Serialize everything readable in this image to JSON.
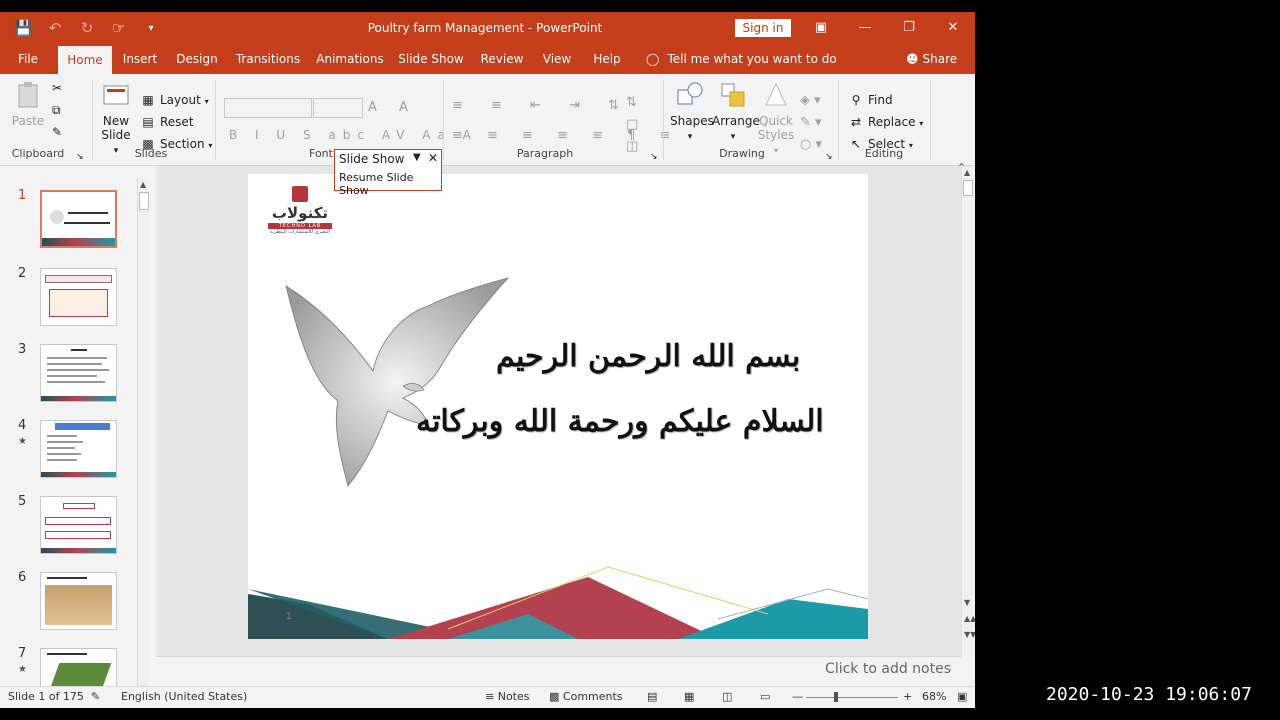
{
  "window": {
    "title": "Poultry farm Management  -  PowerPoint",
    "sign_in": "Sign in",
    "icons": [
      "save-icon",
      "undo-icon",
      "redo-icon",
      "touch-mode-icon",
      "customize-qat-icon"
    ]
  },
  "tabs": [
    {
      "label": "File"
    },
    {
      "label": "Home"
    },
    {
      "label": "Insert"
    },
    {
      "label": "Design"
    },
    {
      "label": "Transitions"
    },
    {
      "label": "Animations"
    },
    {
      "label": "Slide Show"
    },
    {
      "label": "Review"
    },
    {
      "label": "View"
    },
    {
      "label": "Help"
    }
  ],
  "active_tab": "Home",
  "tell_me": "Tell me what you want to do",
  "share": "Share",
  "ribbon": {
    "clipboard": {
      "label": "Clipboard",
      "paste": "Paste"
    },
    "slides": {
      "label": "Slides",
      "new_slide_1": "New",
      "new_slide_2": "Slide",
      "layout": "Layout",
      "reset": "Reset",
      "section": "Section"
    },
    "font": {
      "label": "Font"
    },
    "paragraph": {
      "label": "Paragraph"
    },
    "drawing": {
      "label": "Drawing",
      "shapes": "Shapes",
      "arrange": "Arrange",
      "quick_styles_1": "Quick",
      "quick_styles_2": "Styles"
    },
    "editing": {
      "label": "Editing",
      "find": "Find",
      "replace": "Replace",
      "select": "Select"
    }
  },
  "popup": {
    "title": "Slide Show",
    "resume": "Resume Slide Show"
  },
  "thumbnails": [
    {
      "num": "1",
      "star": ""
    },
    {
      "num": "2",
      "star": ""
    },
    {
      "num": "3",
      "star": ""
    },
    {
      "num": "4",
      "star": "★"
    },
    {
      "num": "5",
      "star": ""
    },
    {
      "num": "6",
      "star": ""
    },
    {
      "num": "7",
      "star": "★"
    }
  ],
  "slide": {
    "logo_ar": "تكنولاب",
    "logo_en": "TECHNO LAB",
    "logo_sub": "البصري للاستشارات البيطرية",
    "line1": "بسم الله الرحمن الرحيم",
    "line2": "السلام عليكم ورحمة الله وبركاته",
    "number": "1"
  },
  "notes_placeholder": "Click to add notes",
  "status": {
    "slide_info": "Slide 1 of 175",
    "language": "English (United States)",
    "notes": "Notes",
    "comments": "Comments",
    "zoom": "68%"
  },
  "timestamp": "2020-10-23 19:06:07"
}
